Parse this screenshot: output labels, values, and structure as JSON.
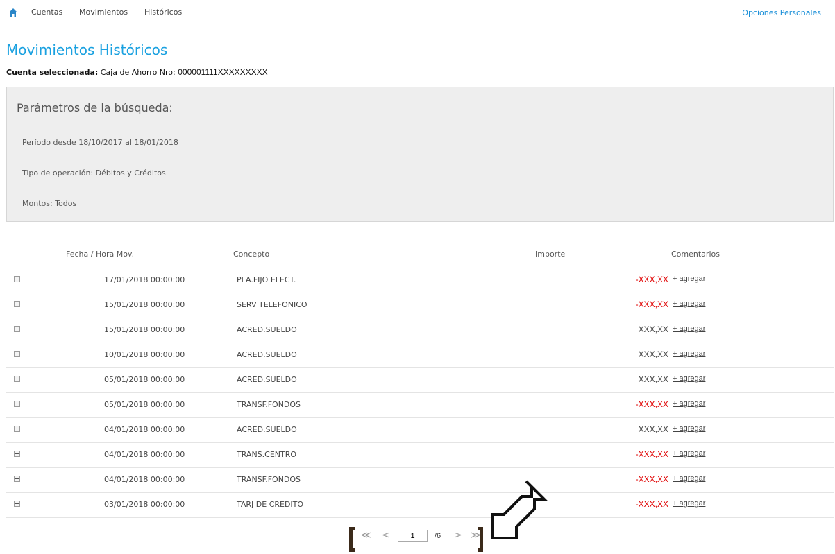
{
  "nav": {
    "items": [
      "Cuentas",
      "Movimientos",
      "Históricos"
    ],
    "opciones": "Opciones Personales"
  },
  "page": {
    "title": "Movimientos Históricos",
    "account_label": "Cuenta seleccionada:",
    "account_type": "Caja de Ahorro Nro:",
    "account_number": "000001111XXXXXXXXX"
  },
  "params": {
    "title": "Parámetros de la búsqueda:",
    "periodo": "Período desde 18/10/2017 al 18/01/2018",
    "tipo": "Tipo de operación: Débitos y Créditos",
    "montos": "Montos: Todos"
  },
  "table": {
    "headers": {
      "fecha": "Fecha / Hora Mov.",
      "concepto": "Concepto",
      "importe": "Importe",
      "comentarios": "Comentarios"
    },
    "rows": [
      {
        "fecha": "17/01/2018 00:00:00",
        "concepto": "PLA.FIJO ELECT.",
        "importe": "-XXX,XX",
        "comentario": "+ agregar"
      },
      {
        "fecha": "15/01/2018 00:00:00",
        "concepto": "SERV TELEFONICO",
        "importe": "-XXX,XX",
        "comentario": "+ agregar"
      },
      {
        "fecha": "15/01/2018 00:00:00",
        "concepto": "ACRED.SUELDO",
        "importe": "XXX,XX",
        "comentario": "+ agregar"
      },
      {
        "fecha": "10/01/2018 00:00:00",
        "concepto": "ACRED.SUELDO",
        "importe": "XXX,XX",
        "comentario": "+ agregar"
      },
      {
        "fecha": "05/01/2018 00:00:00",
        "concepto": "ACRED.SUELDO",
        "importe": "XXX,XX",
        "comentario": "+ agregar"
      },
      {
        "fecha": "05/01/2018 00:00:00",
        "concepto": "TRANSF.FONDOS",
        "importe": "-XXX,XX",
        "comentario": "+ agregar"
      },
      {
        "fecha": "04/01/2018 00:00:00",
        "concepto": "ACRED.SUELDO",
        "importe": "XXX,XX",
        "comentario": "+ agregar"
      },
      {
        "fecha": "04/01/2018 00:00:00",
        "concepto": "TRANS.CENTRO",
        "importe": "-XXX,XX",
        "comentario": "+ agregar"
      },
      {
        "fecha": "04/01/2018 00:00:00",
        "concepto": "TRANSF.FONDOS",
        "importe": "-XXX,XX",
        "comentario": "+ agregar"
      },
      {
        "fecha": "03/01/2018 00:00:00",
        "concepto": "TARJ DE CREDITO",
        "importe": "-XXX,XX",
        "comentario": "+ agregar"
      }
    ]
  },
  "pager": {
    "first": "≪",
    "prev": "<",
    "current": "1",
    "total": "/6",
    "next": ">",
    "last": "≫"
  },
  "colors": {
    "accent": "#1aa1e0",
    "negative": "#e00000",
    "bracket": "#3b2a1a"
  }
}
